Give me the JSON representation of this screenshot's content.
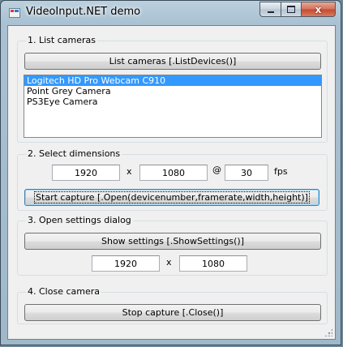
{
  "window": {
    "title": "VideoInput.NET demo",
    "icons": {
      "app": "app-icon",
      "minimize": "minimize-icon",
      "maximize": "maximize-icon",
      "close": "close-icon"
    },
    "close_glyph": "x"
  },
  "list_group": {
    "label": "1. List cameras",
    "button_label": "List cameras [.ListDevices()]",
    "devices": [
      "Logitech HD Pro Webcam C910",
      "Point Grey Camera",
      "PS3Eye Camera"
    ],
    "selected_device": "Logitech HD Pro Webcam C910"
  },
  "dimensions_group": {
    "label": "2. Select dimensions",
    "width_value": "1920",
    "times_label": "x",
    "height_value": "1080",
    "at_label": "@",
    "fps_value": "30",
    "fps_label": "fps",
    "start_button_label": "Start capture [.Open(devicenumber,framerate,width,height)]"
  },
  "settings_group": {
    "label": "3. Open settings dialog",
    "button_label": "Show settings [.ShowSettings()]",
    "width_value": "1920",
    "times_label": "x",
    "height_value": "1080"
  },
  "close_group": {
    "label": "4. Close camera",
    "button_label": "Stop capture [.Close()]"
  },
  "colors": {
    "selection": "#3399ff",
    "close_button": "#c34a2e"
  }
}
